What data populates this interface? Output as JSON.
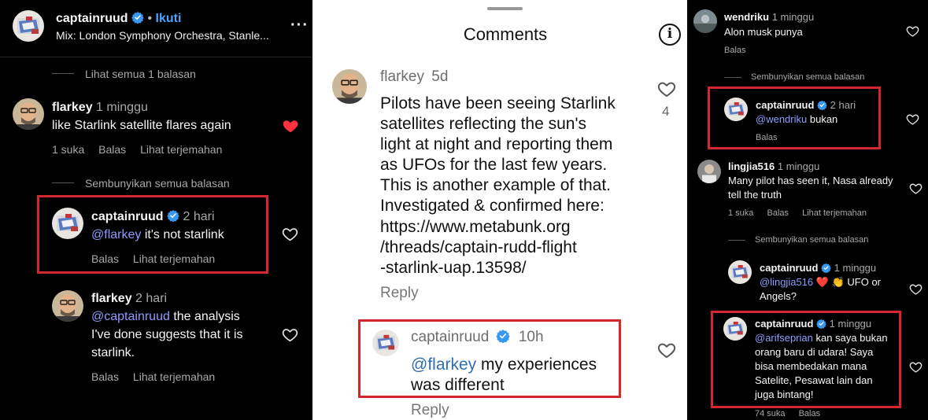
{
  "left": {
    "header": {
      "username": "captainruud",
      "dot": "•",
      "follow": "Ikuti",
      "subtitle": "Mix: London Symphony Orchestra, Stanle..."
    },
    "view_replies": "Lihat semua 1 balasan",
    "comment1": {
      "user": "flarkey",
      "time": "1 minggu",
      "text": "like Starlink satellite flares again",
      "likes": "1 suka",
      "reply": "Balas",
      "translate": "Lihat terjemahan"
    },
    "hide_replies": "Sembunyikan semua balasan",
    "reply1": {
      "user": "captainruud",
      "time": "2 hari",
      "mention": "@flarkey",
      "text": "it's not starlink",
      "reply": "Balas",
      "translate": "Lihat terjemahan"
    },
    "reply2": {
      "user": "flarkey",
      "time": "2 hari",
      "mention": "@captainruud",
      "line1": "the analysis",
      "line2": "I've done suggests that it is",
      "line3": "starlink.",
      "reply": "Balas",
      "translate": "Lihat terjemahan"
    }
  },
  "middle": {
    "title": "Comments",
    "comment": {
      "user": "flarkey",
      "time": "5d",
      "lines": [
        "Pilots have been seeing Starlink",
        "satellites reflecting the sun's",
        "light at night and reporting them",
        "as UFOs for the last few years.",
        "This is another example of that.",
        "Investigated & confirmed here:",
        "https://www.metabunk.org",
        "/threads/captain-rudd-flight",
        "-starlink-uap.13598/"
      ],
      "reply": "Reply",
      "like_count": "4"
    },
    "reply": {
      "user": "captainruud",
      "time": "10h",
      "mention": "@flarkey",
      "text1": "my experiences",
      "text2": "was different",
      "reply": "Reply"
    }
  },
  "right": {
    "c1": {
      "user": "wendriku",
      "time": "1 minggu",
      "text": "Alon musk punya",
      "reply": "Balas"
    },
    "hide1": "Sembunyikan semua balasan",
    "r1": {
      "user": "captainruud",
      "time": "2 hari",
      "mention": "@wendriku",
      "text": "bukan",
      "reply": "Balas"
    },
    "c2": {
      "user": "lingjia516",
      "time": "1 minggu",
      "line1": "Many pilot has seen it, Nasa already",
      "line2": "tell the truth",
      "likes": "1 suka",
      "reply": "Balas",
      "translate": "Lihat terjemahan"
    },
    "hide2": "Sembunyikan semua balasan",
    "r2": {
      "user": "captainruud",
      "time": "1 minggu",
      "mention": "@lingjia516",
      "emoji": "❤️ 👏",
      "text": "UFO or",
      "line2": "Angels?"
    },
    "r3": {
      "user": "captainruud",
      "time": "1 minggu",
      "mention": "@arifseprian",
      "line1": "kan saya bukan",
      "line2": "orang baru di udara! Saya",
      "line3": "bisa membedakan mana",
      "line4": "Satelite, Pesawat lain dan",
      "line5": "juga bintang!",
      "likes": "74 suka",
      "reply": "Balas"
    }
  },
  "colors": {
    "verified": "#3897f0",
    "heart_liked": "#ff3040",
    "highlight_box": "#d3262f",
    "mention_dark": "#8f9cff",
    "mention_light": "#2f6fb0"
  }
}
